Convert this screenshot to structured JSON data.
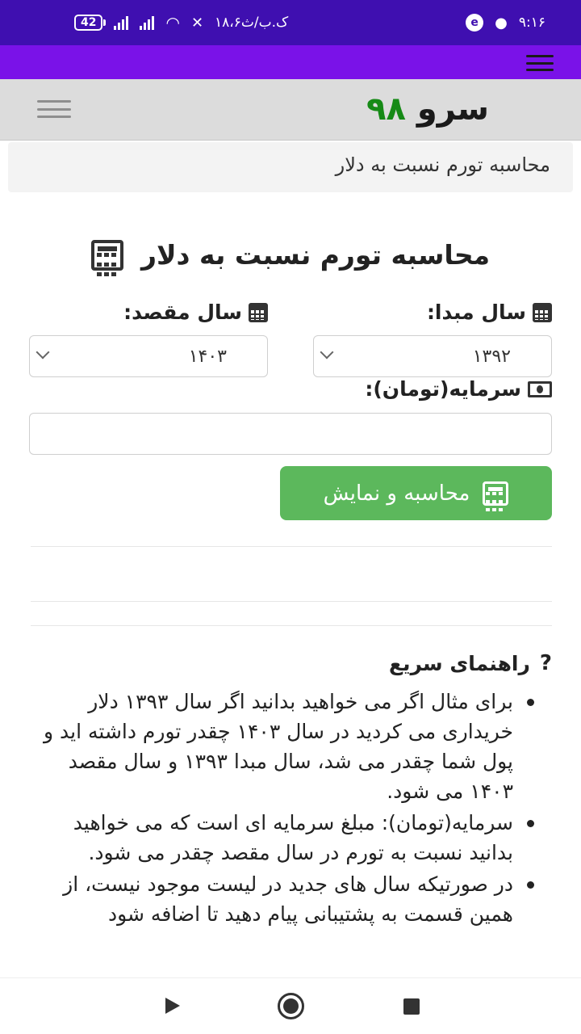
{
  "statusbar": {
    "battery": "42",
    "network_speed": "۱۸،۶ک.ب/ث",
    "time": "۹:۱۶"
  },
  "site": {
    "logo_word": "سرو",
    "logo_number": "۹۸"
  },
  "breadcrumb": "محاسبه تورم نسبت به دلار",
  "page_title": "محاسبه تورم نسبت به دلار",
  "form": {
    "from_year_label": "سال مبدا:",
    "from_year_value": "۱۳۹۲",
    "to_year_label": "سال مقصد:",
    "to_year_value": "۱۴۰۳",
    "capital_label": "سرمایه(تومان):",
    "capital_value": "",
    "submit_label": "محاسبه و نمایش"
  },
  "guide": {
    "title": "راهنمای سریع",
    "items": [
      "برای مثال اگر می خواهید بدانید اگر سال ۱۳۹۳ دلار خریداری می کردید در سال ۱۴۰۳ چقدر تورم داشته اید و پول شما چقدر می شد، سال مبدا ۱۳۹۳ و سال مقصد ۱۴۰۳ می شود.",
      "سرمایه(تومان): مبلغ سرمایه ای است که می خواهید بدانید نسبت به تورم در سال مقصد چقدر می شود.",
      "در صورتیکه سال های جدید در لیست موجود نیست، از همین قسمت به پشتیبانی پیام دهید تا اضافه شود"
    ]
  }
}
